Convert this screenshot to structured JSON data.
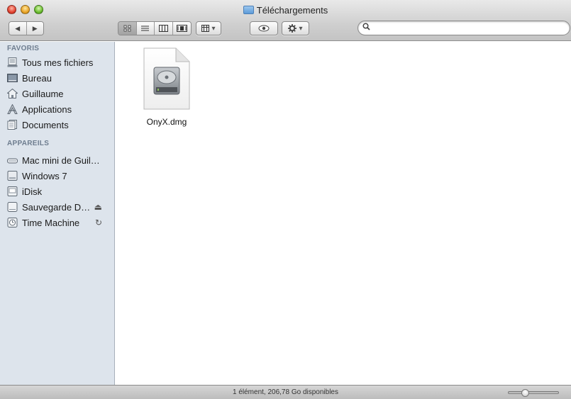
{
  "window": {
    "title": "Téléchargements",
    "folder_icon": "downloads-folder-icon"
  },
  "toolbar": {
    "back_glyph": "◀",
    "forward_glyph": "▶",
    "arrange_glyph": "▾",
    "action_glyph": "▾",
    "search": {
      "value": "",
      "placeholder": ""
    }
  },
  "sidebar": {
    "favorites_title": "FAVORIS",
    "favorites": [
      {
        "label": "Tous mes fichiers",
        "icon": "all-files-icon"
      },
      {
        "label": "Bureau",
        "icon": "desktop-icon"
      },
      {
        "label": "Guillaume",
        "icon": "home-icon"
      },
      {
        "label": "Applications",
        "icon": "applications-icon"
      },
      {
        "label": "Documents",
        "icon": "documents-icon"
      }
    ],
    "devices_title": "APPAREILS",
    "devices": [
      {
        "label": "Mac mini de Guil…",
        "icon": "computer-icon"
      },
      {
        "label": "Windows 7",
        "icon": "disk-icon"
      },
      {
        "label": "iDisk",
        "icon": "idisk-icon"
      },
      {
        "label": "Sauvegarde D…",
        "icon": "external-disk-icon",
        "accessory": "⏏"
      },
      {
        "label": "Time Machine",
        "icon": "time-machine-icon",
        "accessory": "↻"
      }
    ]
  },
  "files": [
    {
      "name": "OnyX.dmg",
      "icon": "disk-image-icon"
    }
  ],
  "status": {
    "text": "1 élément, 206,78 Go disponibles",
    "icon_size_fraction": 0.3
  }
}
